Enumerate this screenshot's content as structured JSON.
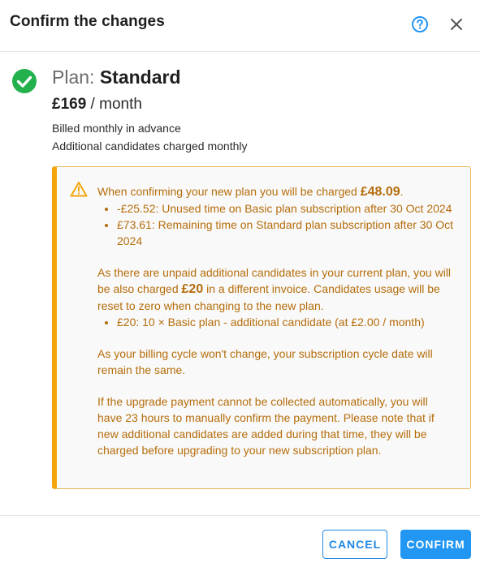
{
  "dialog": {
    "title": "Confirm the changes"
  },
  "icons": {
    "help": "help-circle-icon",
    "close": "close-icon",
    "success": "check-circle-icon",
    "warning": "warning-triangle-icon"
  },
  "colors": {
    "accent": "#2196f3",
    "success": "#22b14c",
    "warning_border": "#f4a50b",
    "warning_text": "#b56d0b"
  },
  "plan": {
    "prefix": "Plan: ",
    "name": "Standard",
    "price": "£169",
    "period": " / month",
    "billing": "Billed monthly in advance",
    "additional": "Additional candidates charged monthly"
  },
  "warning": {
    "charge_intro": "When confirming your new plan you will be charged ",
    "charge_amount": "£48.09",
    "charge_end": ".",
    "charge_items": [
      "-£25.52: Unused time on Basic plan subscription after 30 Oct 2024",
      "£73.61: Remaining time on Standard plan subscription after 30 Oct 2024"
    ],
    "unpaid_intro": "As there are unpaid additional candidates in your current plan, you will be also charged ",
    "unpaid_amount": "£20",
    "unpaid_end": " in a different invoice. Candidates usage will be reset to zero when changing to the new plan.",
    "unpaid_items": [
      "£20: 10 × Basic plan - additional candidate (at £2.00 / month)"
    ],
    "cycle_note": "As your billing cycle won't change, your subscription cycle date will remain the same.",
    "payment_note": "If the upgrade payment cannot be collected automatically, you will have 23 hours to manually confirm the payment. Please note that if new additional candidates are added during that time, they will be charged before upgrading to your new subscription plan."
  },
  "footer": {
    "cancel_label": "CANCEL",
    "confirm_label": "CONFIRM"
  }
}
